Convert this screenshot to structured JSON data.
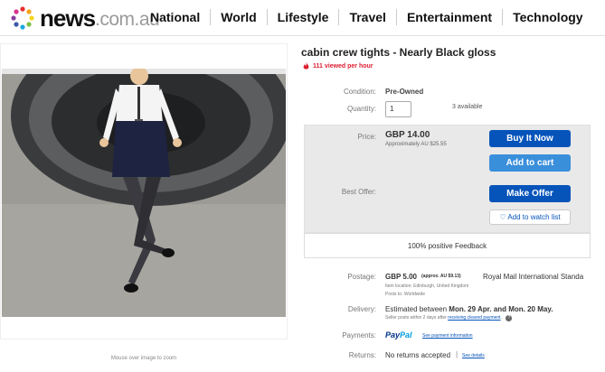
{
  "header": {
    "brand": "news",
    "brand_domain": ".com.au",
    "nav": [
      "National",
      "World",
      "Lifestyle",
      "Travel",
      "Entertainment",
      "Technology"
    ]
  },
  "gallery": {
    "caption": "Mouse over image to zoom"
  },
  "listing": {
    "title": "cabin crew tights - Nearly Black gloss",
    "views": "111 viewed per hour",
    "condition_label": "Condition:",
    "condition_value": "Pre-Owned",
    "quantity_label": "Quantity:",
    "quantity_value": "1",
    "available": "3 available",
    "price_label": "Price:",
    "price": "GBP 14.00",
    "price_approx": "Approximately AU $25.55",
    "buy_now": "Buy It Now",
    "add_to_cart": "Add to cart",
    "best_offer_label": "Best Offer:",
    "make_offer": "Make Offer",
    "watch_list": "Add to watch list",
    "feedback": "100% positive Feedback",
    "postage_label": "Postage:",
    "postage_value": "GBP 5.00",
    "postage_approx": "(approx. AU $9.13)",
    "postage_service": "Royal Mail International Standa",
    "item_location": "Item location:  Edinburgh, United Kingdom",
    "posts_to": "Posts to:  Worldwide",
    "delivery_label": "Delivery:",
    "delivery_prefix": "Estimated between",
    "delivery_dates": "Mon. 29 Apr. and Mon. 20 May.",
    "delivery_note": "Seller posts within 2 days after",
    "delivery_link": "receiving cleared payment",
    "payments_label": "Payments:",
    "paypal_a": "Pay",
    "paypal_b": "Pal",
    "payment_link": "See payment information",
    "returns_label": "Returns:",
    "returns_value": "No returns accepted",
    "returns_link": "See details"
  },
  "colors": {
    "primary_button": "#0654ba",
    "cart_button": "#3a8fdb",
    "views_red": "#dd1e31"
  }
}
